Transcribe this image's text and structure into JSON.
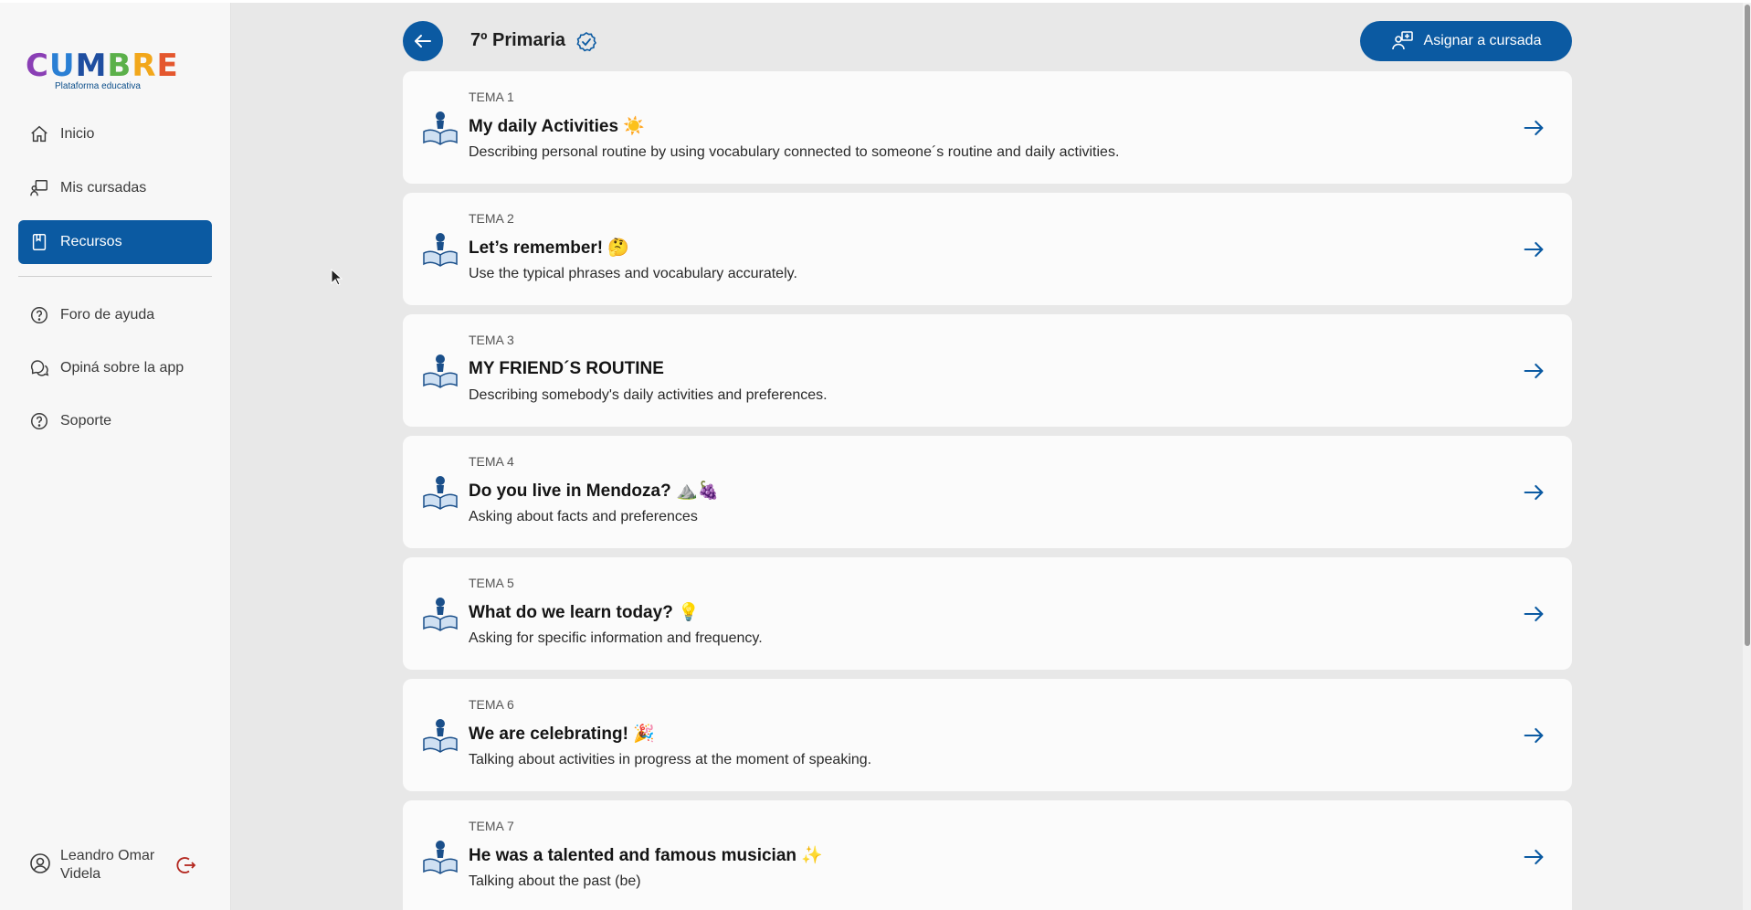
{
  "app": {
    "logo_letters": [
      "C",
      "U",
      "M",
      "B",
      "R",
      "E"
    ],
    "logo_colors": [
      "#8a3fb5",
      "#2a7fd4",
      "#1f4ea0",
      "#5bb04a",
      "#f2a71b",
      "#e4572e"
    ],
    "logo_subtitle": "Plataforma educativa",
    "primary_color": "#0b5aa2"
  },
  "sidebar": {
    "items": [
      {
        "label": "Inicio",
        "icon": "home-icon",
        "active": false
      },
      {
        "label": "Mis cursadas",
        "icon": "classroom-icon",
        "active": false
      },
      {
        "label": "Recursos",
        "icon": "book-icon",
        "active": true
      },
      {
        "label": "Foro de ayuda",
        "icon": "help-circle-icon",
        "active": false
      },
      {
        "label": "Opiná sobre la app",
        "icon": "chat-bubbles-icon",
        "active": false
      },
      {
        "label": "Soporte",
        "icon": "help-circle-icon",
        "active": false
      }
    ],
    "user_name": "Leandro Omar Videla"
  },
  "header": {
    "course_title": "7º Primaria",
    "assign_label": "Asignar a cursada"
  },
  "topics": [
    {
      "number": "TEMA 1",
      "title": "My daily Activities",
      "emoji": "☀️",
      "description": "Describing personal routine by using vocabulary connected to someone´s routine and daily activities."
    },
    {
      "number": "TEMA 2",
      "title": "Let’s remember!",
      "emoji": "🤔",
      "description": "Use the typical phrases and vocabulary accurately."
    },
    {
      "number": "TEMA 3",
      "title": "MY FRIEND´S ROUTINE",
      "emoji": "",
      "description": "Describing somebody's daily activities and preferences."
    },
    {
      "number": "TEMA 4",
      "title": "Do you live in Mendoza?",
      "emoji": "⛰️🍇",
      "description": "Asking about facts and preferences"
    },
    {
      "number": "TEMA 5",
      "title": "What do we learn today?",
      "emoji": "💡",
      "description": "Asking for specific information and frequency."
    },
    {
      "number": "TEMA 6",
      "title": "We are celebrating!",
      "emoji": "🎉",
      "description": "Talking about activities in progress at the moment of speaking."
    },
    {
      "number": "TEMA 7",
      "title": "He was a talented and famous musician",
      "emoji": "✨",
      "description": "Talking about the past (be)"
    }
  ]
}
